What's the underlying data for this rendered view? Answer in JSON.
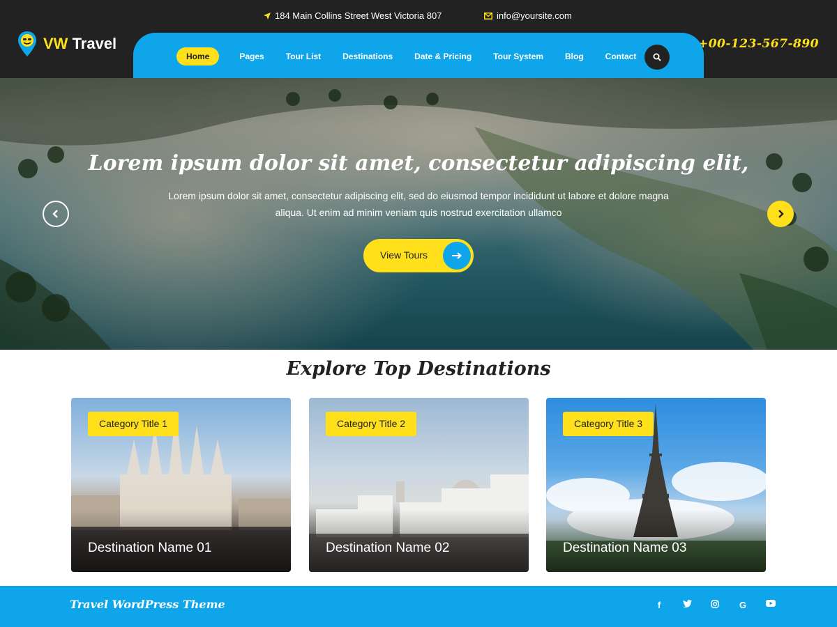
{
  "brand": {
    "name_prefix": "VW",
    "name_suffix": " Travel"
  },
  "contact": {
    "address": "184 Main Collins Street West Victoria 807",
    "email": "info@yoursite.com",
    "phone": "+00-123-567-890"
  },
  "nav": {
    "items": [
      {
        "label": "Home",
        "active": true
      },
      {
        "label": "Pages"
      },
      {
        "label": "Tour List"
      },
      {
        "label": "Destinations"
      },
      {
        "label": "Date & Pricing"
      },
      {
        "label": "Tour System"
      },
      {
        "label": "Blog"
      },
      {
        "label": "Contact"
      }
    ],
    "search_icon": "search-icon"
  },
  "hero": {
    "title": "Lorem ipsum dolor sit amet, consectetur adipiscing elit,",
    "text": "Lorem ipsum dolor sit amet, consectetur adipiscing elit, sed do eiusmod tempor incididunt ut labore et dolore magna aliqua. Ut enim ad minim veniam quis nostrud exercitation ullamco",
    "button_label": "View Tours"
  },
  "destinations": {
    "title": "Explore Top Destinations",
    "cards": [
      {
        "category": "Category Title 1",
        "name": "Destination Name 01"
      },
      {
        "category": "Category Title 2",
        "name": "Destination Name 02"
      },
      {
        "category": "Category Title 3",
        "name": "Destination Name 03"
      }
    ]
  },
  "footer": {
    "text": "Travel WordPress Theme",
    "social": [
      "facebook-icon",
      "twitter-icon",
      "instagram-icon",
      "google-icon",
      "youtube-icon"
    ]
  },
  "colors": {
    "accent_yellow": "#ffe01b",
    "accent_blue": "#0ea5ea",
    "dark": "#222222"
  }
}
